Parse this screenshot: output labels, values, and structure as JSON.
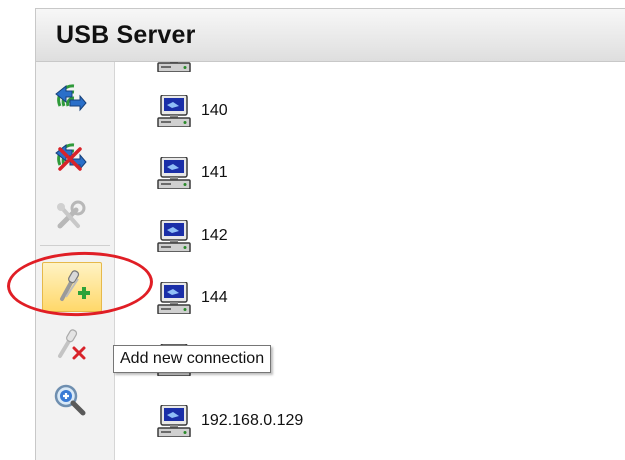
{
  "window": {
    "title": "USB Server"
  },
  "toolbar": {
    "buttons": [
      {
        "icon": "connect-network-icon",
        "enabled": true
      },
      {
        "icon": "disconnect-network-icon",
        "enabled": true
      },
      {
        "icon": "settings-tools-icon",
        "enabled": false
      },
      {
        "icon": "add-connection-icon",
        "enabled": true,
        "state": "hover"
      },
      {
        "icon": "remove-connection-icon",
        "enabled": false
      },
      {
        "icon": "search-zoom-icon",
        "enabled": true
      }
    ]
  },
  "tree": {
    "items": [
      {
        "label": "",
        "icon": "computer-icon",
        "partial": true
      },
      {
        "label": "140",
        "icon": "computer-icon"
      },
      {
        "label": "141",
        "icon": "computer-icon"
      },
      {
        "label": "142",
        "icon": "computer-icon"
      },
      {
        "label": "144",
        "icon": "computer-icon"
      },
      {
        "label": "",
        "icon": "computer-icon",
        "obscured": true
      },
      {
        "label": "192.168.0.129",
        "icon": "computer-icon"
      }
    ]
  },
  "tooltip": {
    "text": "Add new connection"
  },
  "colors": {
    "annotation_circle": "#e01e25",
    "hover_highlight": "#ffd86a",
    "monitor_screen": "#1b2fa8"
  }
}
